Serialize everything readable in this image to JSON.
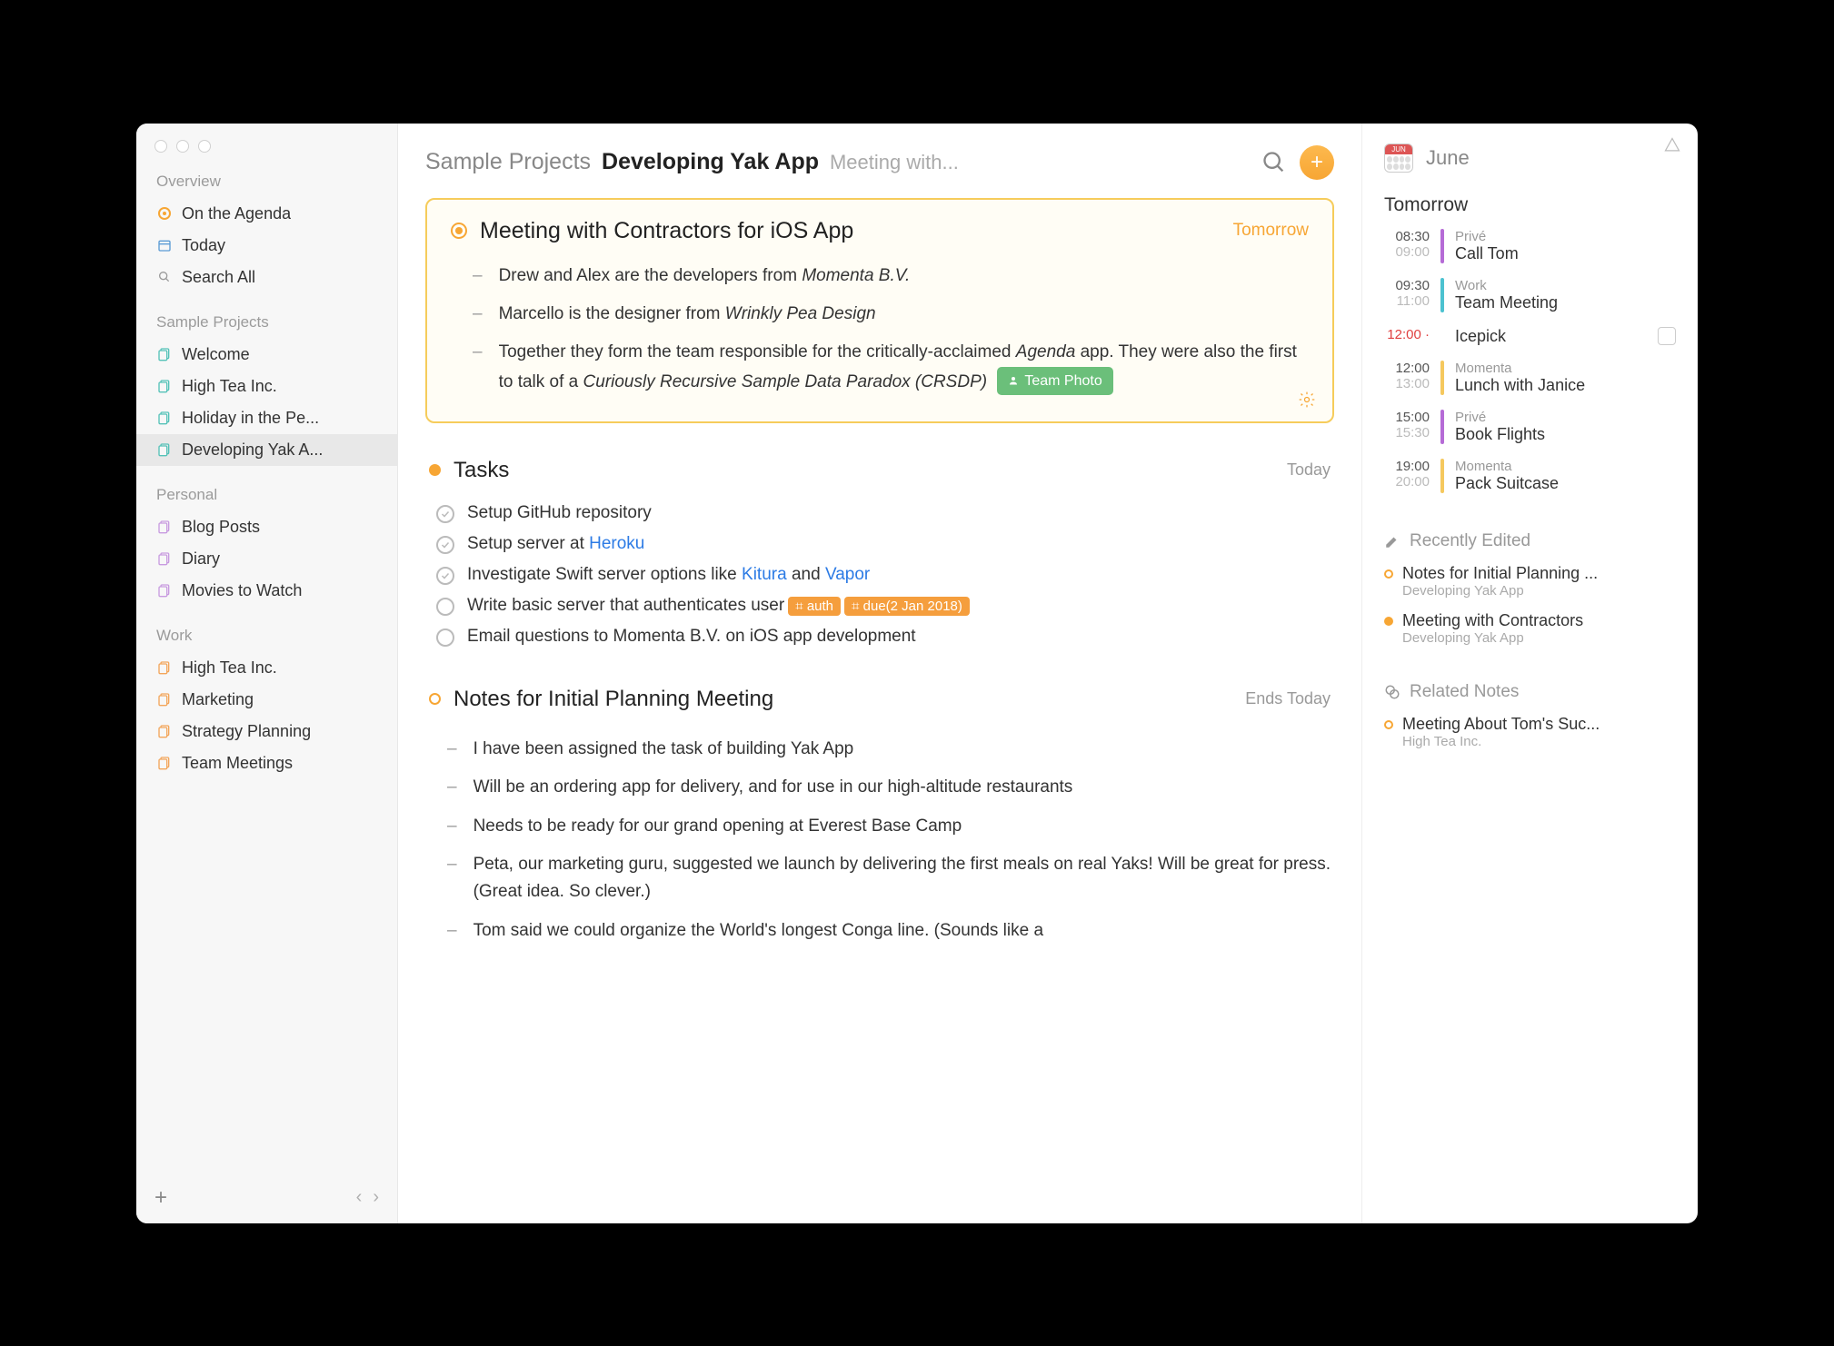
{
  "sidebar": {
    "overview_label": "Overview",
    "overview_items": [
      {
        "label": "On the Agenda",
        "icon": "agenda"
      },
      {
        "label": "Today",
        "icon": "today"
      },
      {
        "label": "Search All",
        "icon": "search"
      }
    ],
    "groups": [
      {
        "title": "Sample Projects",
        "color": "#55C2B8",
        "items": [
          {
            "label": "Welcome"
          },
          {
            "label": "High Tea Inc."
          },
          {
            "label": "Holiday in the Pe..."
          },
          {
            "label": "Developing Yak A...",
            "active": true
          }
        ]
      },
      {
        "title": "Personal",
        "color": "#C89BE0",
        "items": [
          {
            "label": "Blog Posts"
          },
          {
            "label": "Diary"
          },
          {
            "label": "Movies to Watch"
          }
        ]
      },
      {
        "title": "Work",
        "color": "#F3A65B",
        "items": [
          {
            "label": "High Tea Inc."
          },
          {
            "label": "Marketing"
          },
          {
            "label": "Strategy Planning"
          },
          {
            "label": "Team Meetings"
          }
        ]
      }
    ]
  },
  "header": {
    "breadcrumb_parent": "Sample Projects",
    "breadcrumb_current": "Developing Yak App",
    "breadcrumb_tail": "Meeting with..."
  },
  "note1": {
    "title": "Meeting with Contractors for iOS App",
    "meta": "Tomorrow",
    "bullets": [
      "Drew and Alex are the developers from <i>Momenta B.V.</i>",
      "Marcello is the designer from <i>Wrinkly Pea Design</i>",
      "Together they form the team responsible for the critically-acclaimed <i>Agenda</i> app. They were also the first to talk of a <i>Curiously Recursive Sample Data Paradox (CRSDP)</i>"
    ],
    "tag": "Team Photo"
  },
  "tasks_section": {
    "title": "Tasks",
    "meta": "Today",
    "tasks": [
      {
        "done": true,
        "html": "Setup GitHub repository"
      },
      {
        "done": true,
        "html": "Setup server at <a>Heroku</a>"
      },
      {
        "done": true,
        "html": "Investigate Swift server options like <a>Kitura</a> and <a>Vapor</a>"
      },
      {
        "done": false,
        "html": "Write basic server that authenticates user",
        "tags": [
          "⌗ auth",
          "⌗ due(2 Jan 2018)"
        ]
      },
      {
        "done": false,
        "html": "Email questions to Momenta B.V. on iOS app development"
      }
    ]
  },
  "notes_section": {
    "title": "Notes for Initial Planning Meeting",
    "meta": "Ends Today",
    "bullets": [
      "I have been assigned the task of building Yak App",
      "Will be an ordering app for delivery, and for use in our high-altitude restaurants",
      "Needs to be ready for our grand opening at Everest Base Camp",
      "Peta, our marketing guru, suggested we launch by delivering the first meals on real Yaks! Will be great for press. (Great idea. So clever.)",
      "Tom said we could organize the World's longest Conga line. (Sounds like a"
    ]
  },
  "calendar": {
    "month_badge": "JUN",
    "month": "June",
    "day_label": "Tomorrow",
    "events": [
      {
        "t1": "08:30",
        "t2": "09:00",
        "cal": "Privé",
        "title": "Call Tom",
        "color": "#B56BD6"
      },
      {
        "t1": "09:30",
        "t2": "11:00",
        "cal": "Work",
        "title": "Team Meeting",
        "color": "#4CC2D0"
      },
      {
        "t1": "12:00",
        "t1_red": true,
        "cal": "",
        "title": "Icepick",
        "color": "",
        "note_icon": true
      },
      {
        "t1": "12:00",
        "t2": "13:00",
        "cal": "Momenta",
        "title": "Lunch with Janice",
        "color": "#F5C85E"
      },
      {
        "t1": "15:00",
        "t2": "15:30",
        "cal": "Privé",
        "title": "Book Flights",
        "color": "#B56BD6"
      },
      {
        "t1": "19:00",
        "t2": "20:00",
        "cal": "Momenta",
        "title": "Pack Suitcase",
        "color": "#F5C85E"
      }
    ]
  },
  "recently_edited": {
    "title": "Recently Edited",
    "items": [
      {
        "title": "Notes for Initial Planning ...",
        "sub": "Developing Yak App",
        "filled": false
      },
      {
        "title": "Meeting with Contractors",
        "sub": "Developing Yak App",
        "filled": true
      }
    ]
  },
  "related_notes": {
    "title": "Related Notes",
    "items": [
      {
        "title": "Meeting About Tom's Suc...",
        "sub": "High Tea Inc.",
        "filled": false
      }
    ]
  }
}
